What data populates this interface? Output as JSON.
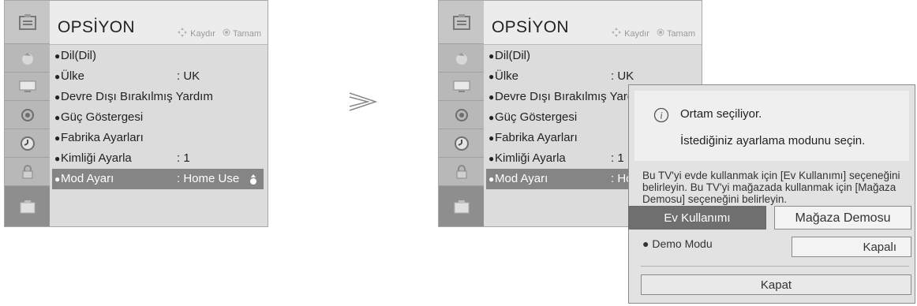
{
  "menu": {
    "title": "OPSİYON",
    "hint_move": "Kaydır",
    "hint_ok": "Tamam",
    "items": [
      {
        "label": "Dil(Dil)",
        "value": ""
      },
      {
        "label": "Ülke",
        "value": ": UK"
      },
      {
        "label": "Devre Dışı Bırakılmış Yardım",
        "value": ""
      },
      {
        "label": "Güç Göstergesi",
        "value": ""
      },
      {
        "label": "Fabrika Ayarları",
        "value": ""
      },
      {
        "label": "Kimliği Ayarla",
        "value": ": 1"
      },
      {
        "label": "Mod Ayarı",
        "value": ": Home Use"
      }
    ],
    "items_right": [
      {
        "label": "Dil(Dil)",
        "value": ""
      },
      {
        "label": "Ülke",
        "value": ": UK"
      },
      {
        "label": "Devre Dışı Bırakılmış Yardım",
        "value": ""
      },
      {
        "label": "Güç Göstergesi",
        "value": ""
      },
      {
        "label": "Fabrika Ayarları",
        "value": ""
      },
      {
        "label": "Kimliği Ayarla",
        "value": ": 1"
      },
      {
        "label": "Mod Ayarı",
        "value": ": Home Use"
      }
    ]
  },
  "dialog": {
    "title": "Ortam seçiliyor.",
    "subtitle": "İstediğiniz ayarlama modunu seçin.",
    "message": "Bu TV'yi evde kullanmak için [Ev Kullanımı] seçeneğini belirleyin. Bu TV'yi mağazada kullanmak için [Mağaza Demosu] seçeneğini belirleyin.",
    "btn_home": "Ev Kullanımı",
    "btn_store": "Mağaza Demosu",
    "demo_label": "Demo Modu",
    "demo_value": "Kapalı",
    "close": "Kapat"
  },
  "colors": {
    "panel_bg": "#dcdcdc",
    "selected_bg": "#858585",
    "button_selected": "#6f6f6f"
  }
}
